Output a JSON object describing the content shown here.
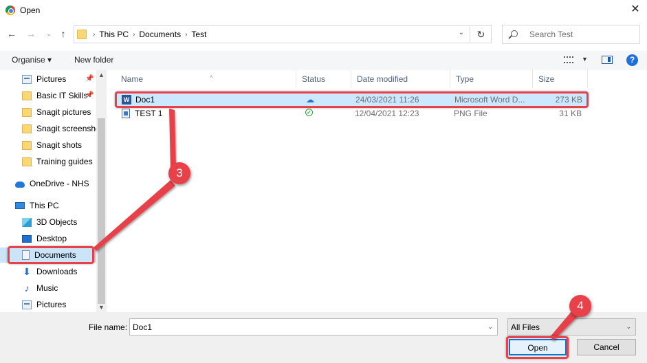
{
  "window": {
    "title": "Open"
  },
  "address": {
    "crumbs": [
      "This PC",
      "Documents",
      "Test"
    ],
    "search_placeholder": "Search Test"
  },
  "toolbar": {
    "organise": "Organise ▾",
    "new_folder": "New folder"
  },
  "sidebar": {
    "items": [
      {
        "label": "Pictures",
        "icon": "pictures-icon",
        "pinned": true
      },
      {
        "label": "Basic IT Skills",
        "icon": "folder-icon",
        "pinned": true
      },
      {
        "label": "Snagit pictures",
        "icon": "folder-icon"
      },
      {
        "label": "Snagit screensho",
        "icon": "folder-icon"
      },
      {
        "label": "Snagit shots",
        "icon": "folder-icon"
      },
      {
        "label": "Training guides",
        "icon": "folder-icon"
      },
      {
        "label": "OneDrive - NHS",
        "icon": "onedrive-icon"
      },
      {
        "label": "This PC",
        "icon": "computer-icon"
      },
      {
        "label": "3D Objects",
        "icon": "3d-objects-icon"
      },
      {
        "label": "Desktop",
        "icon": "desktop-icon"
      },
      {
        "label": "Documents",
        "icon": "documents-icon",
        "selected": true
      },
      {
        "label": "Downloads",
        "icon": "downloads-icon"
      },
      {
        "label": "Music",
        "icon": "music-icon"
      },
      {
        "label": "Pictures",
        "icon": "pictures-icon"
      }
    ]
  },
  "columns": {
    "name": "Name",
    "status": "Status",
    "date": "Date modified",
    "type": "Type",
    "size": "Size"
  },
  "files": [
    {
      "name": "Doc1",
      "status": "cloud",
      "date": "24/03/2021 11:26",
      "type": "Microsoft Word D...",
      "size": "273 KB",
      "icon": "word-document-icon",
      "selected": true
    },
    {
      "name": "TEST 1",
      "status": "synced",
      "date": "12/04/2021 12:23",
      "type": "PNG File",
      "size": "31 KB",
      "icon": "image-file-icon"
    }
  ],
  "bottom": {
    "file_name_label": "File name:",
    "file_name_value": "Doc1",
    "filter_value": "All Files",
    "open_label": "Open",
    "cancel_label": "Cancel"
  },
  "annotations": {
    "step3": "3",
    "step4": "4"
  },
  "colors": {
    "annotation": "#e8414a",
    "selection": "#cce8ff",
    "accent": "#0078d7"
  }
}
